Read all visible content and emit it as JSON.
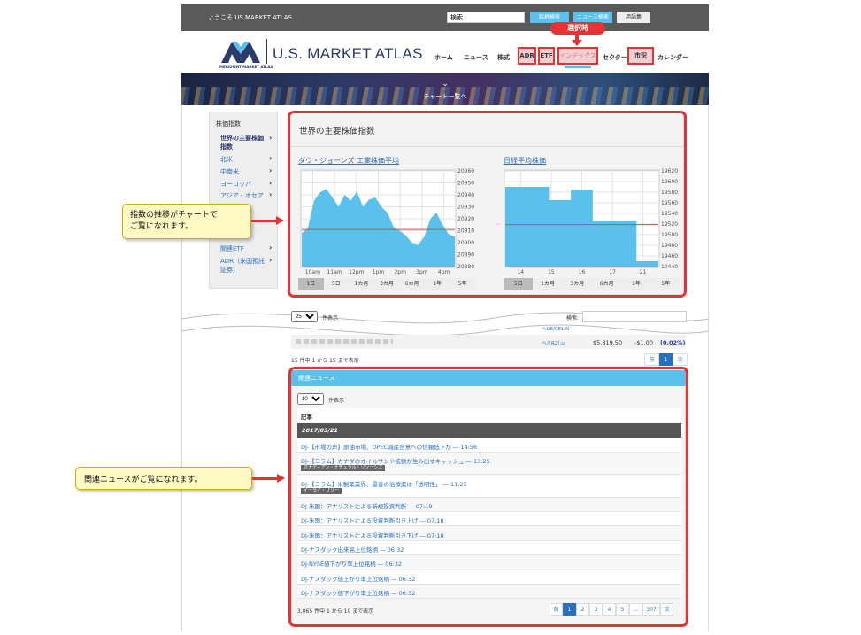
{
  "topbar": {
    "welcome": "ようこそ US MARKET ATLAS",
    "search_value": "検索",
    "buttons": [
      "銘柄検索",
      "ニュース検索",
      "用語集"
    ]
  },
  "header": {
    "logo_mark_text": "MERIDIENT MARKET ATLAS",
    "brand": "U.S. MARKET ATLAS",
    "nav": [
      "ホーム",
      "ニュース",
      "株式",
      "ADR",
      "ETF",
      "インデックス",
      "セクター",
      "市況",
      "カレンダー"
    ],
    "selected_badge": "選択時"
  },
  "banner": {
    "label": "チャート一覧へ"
  },
  "sidebar": {
    "heading": "株価指数",
    "items": [
      "世界の主要株価指数",
      "北米",
      "中南米",
      "ヨーロッパ",
      "アジア・オセア"
    ],
    "etf_items": [
      "関連ETF",
      "ADR（米国預託証券）"
    ]
  },
  "main": {
    "title": "世界の主要株価指数",
    "left_chart": {
      "title": "ダウ・ジョーンズ 工業株価平均",
      "tabs": [
        "1日",
        "5日",
        "1カ月",
        "3カ月",
        "6カ月",
        "1年",
        "5年"
      ],
      "selected_tab": "1日"
    },
    "right_chart": {
      "title": "日経平均株価",
      "tabs": [
        "5日",
        "1カ月",
        "3カ月",
        "6カ月",
        "1年",
        "5年"
      ],
      "selected_tab": "5日"
    }
  },
  "chart_data": [
    {
      "type": "area",
      "title": "ダウ・ジョーンズ 工業株価平均",
      "x": [
        "10am",
        "11am",
        "12pm",
        "1pm",
        "2pm",
        "3pm",
        "4pm"
      ],
      "y_ticks": [
        20960,
        20950,
        20940,
        20930,
        20920,
        20910,
        20900,
        20890,
        20880
      ],
      "ylim": [
        20880,
        20960
      ],
      "series": [
        {
          "values": [
            20908,
            20912,
            20935,
            20942,
            20945,
            20938,
            20930,
            20940,
            20935,
            20943,
            20930,
            20936,
            20938,
            20930,
            20925,
            20913,
            20910,
            20906,
            20900,
            20898,
            20905,
            20920,
            20925,
            20915,
            20907,
            20905
          ]
        }
      ],
      "reference_line": 20911,
      "grid": true
    },
    {
      "type": "area",
      "title": "日経平均株価",
      "x": [
        "14",
        "15",
        "16",
        "17",
        "21"
      ],
      "y_ticks": [
        19620,
        19600,
        19580,
        19560,
        19540,
        19520,
        19500,
        19480,
        19460,
        19440
      ],
      "ylim": [
        19440,
        19620
      ],
      "series": [
        {
          "values": [
            19590,
            19590,
            19565,
            19585,
            19525,
            19525,
            19450
          ]
        }
      ],
      "reference_line": 19519,
      "grid": true
    }
  ],
  "table": {
    "per_page": "25",
    "per_page_suffix": "件表示",
    "search_label": "検索:",
    "row_links": [
      "ヘU8/0E1.N",
      "ヘ入R2[.ul"
    ],
    "row_price": "$5,819.50",
    "row_change": "-$1.00",
    "row_change_pct": "(0.02%)",
    "summary": "15 件中 1 から 15 まで表示",
    "pager": [
      "前",
      "1",
      "次"
    ]
  },
  "news": {
    "heading": "関連ニュース",
    "per_page": "10",
    "per_page_suffix": "件表示",
    "col_header": "記事",
    "date": "2017/03/21",
    "items": [
      {
        "text": "DJ-【市場の声】原油市場、OPEC減産合意への信頼低下か ― 14:56",
        "tag": ""
      },
      {
        "text": "DJ-【コラム】カナダのオイルサンド拡張が生み出すキャッシュ ― 13:25",
        "tag": "カナディアン・ナチュラル・リソーシズ"
      },
      {
        "text": "DJ-【コラム】米製薬業界、最善の治療薬は「透明性」 ― 11:25",
        "tag": "イーライ・リリー"
      },
      {
        "text": "DJ-米国：アナリストによる新規投資判断 ― 07:19",
        "tag": ""
      },
      {
        "text": "DJ-米国：アナリストによる投資判断引き上げ ― 07:18",
        "tag": ""
      },
      {
        "text": "DJ-米国：アナリストによる投資判断引き下げ ― 07:18",
        "tag": ""
      },
      {
        "text": "DJ-ナスダック出来高上位銘柄 ― 06:32",
        "tag": ""
      },
      {
        "text": "DJ-NYSE値下がり率上位銘柄 ― 06:32",
        "tag": ""
      },
      {
        "text": "DJ-ナスダック値上がり率上位銘柄 ― 06:32",
        "tag": ""
      },
      {
        "text": "DJ-ナスダック値下がり率上位銘柄 ― 06:32",
        "tag": ""
      }
    ],
    "summary": "3,065 件中 1 から 10 まで表示",
    "pager": [
      "前",
      "1",
      "2",
      "3",
      "4",
      "5",
      "…",
      "307",
      "次"
    ]
  },
  "callouts": {
    "chart": "指数の推移がチャートで\nご覧になれます。",
    "news": "関連ニュースがご覧になれます。"
  },
  "colors": {
    "accent": "#5bc0eb",
    "highlight": "#e53333",
    "link": "#2a6fbf",
    "navy": "#2a3a6a"
  }
}
